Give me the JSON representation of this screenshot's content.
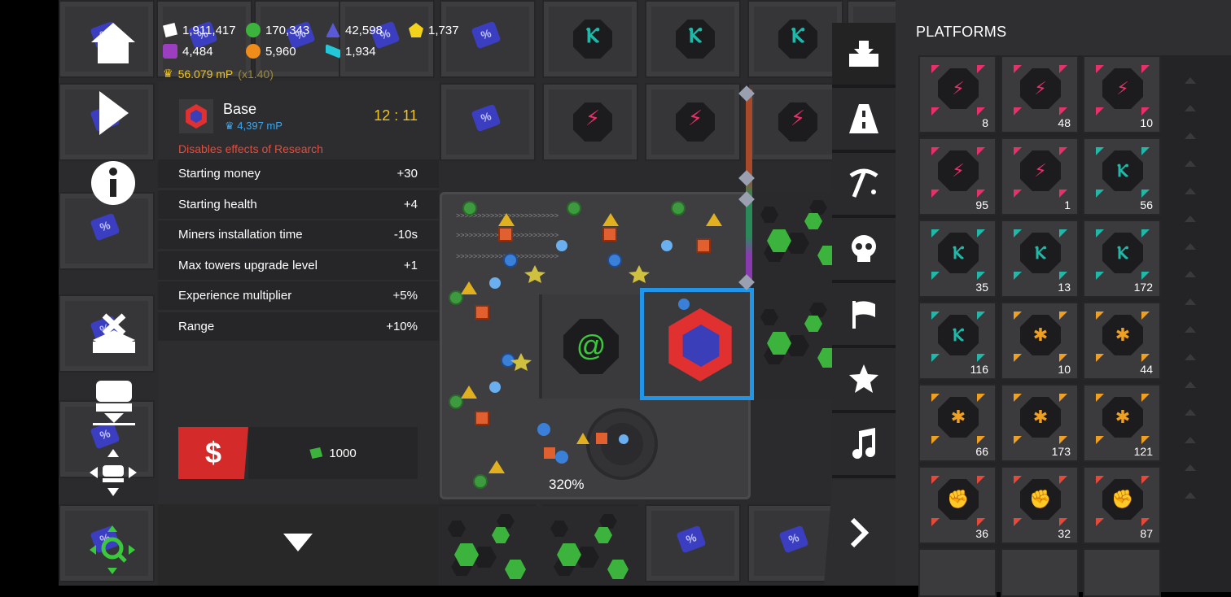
{
  "resources": [
    {
      "icon": "cash-resource-icon",
      "value": "1,911,417",
      "color": "#ffffff"
    },
    {
      "icon": "green-resource-icon",
      "value": "170,343",
      "color": "#3cb33c"
    },
    {
      "icon": "scalar-resource-icon",
      "value": "42,598",
      "color": "#5a5ad8"
    },
    {
      "icon": "yellow-resource-icon",
      "value": "1,737",
      "color": "#f2d21a"
    },
    {
      "icon": "purple-resource-icon",
      "value": "4,484",
      "color": "#9b3fc0"
    },
    {
      "icon": "orange-resource-icon",
      "value": "5,960",
      "color": "#f08c1a"
    },
    {
      "icon": "cyan-resource-icon",
      "value": "1,934",
      "color": "#22c8d8"
    }
  ],
  "mp": {
    "value": "56.079 mP",
    "multiplier": "(x1.40)"
  },
  "base_panel": {
    "title": "Base",
    "mp": "4,397 mP",
    "timer": "12 : 11",
    "warning": "Disables effects of Research",
    "stats": [
      {
        "label": "Starting money",
        "value": "+30"
      },
      {
        "label": "Starting health",
        "value": "+4"
      },
      {
        "label": "Miners installation time",
        "value": "-10s"
      },
      {
        "label": "Max towers upgrade level",
        "value": "+1"
      },
      {
        "label": "Experience multiplier",
        "value": "+5%"
      },
      {
        "label": "Range",
        "value": "+10%"
      }
    ],
    "cost": "1000"
  },
  "zoom": "320%",
  "platforms_title": "PLATFORMS",
  "platforms": [
    {
      "count": "8",
      "color": "#e8306a",
      "glyph": "⚡"
    },
    {
      "count": "48",
      "color": "#e8306a",
      "glyph": "⚡"
    },
    {
      "count": "10",
      "color": "#e8306a",
      "glyph": "⚡"
    },
    {
      "count": "95",
      "color": "#e8306a",
      "glyph": "⚡"
    },
    {
      "count": "1",
      "color": "#e8306a",
      "glyph": "⚡"
    },
    {
      "count": "56",
      "color": "#20b8a8",
      "glyph": "Ⲕ"
    },
    {
      "count": "35",
      "color": "#20b8a8",
      "glyph": "Ⲕ"
    },
    {
      "count": "13",
      "color": "#20b8a8",
      "glyph": "Ⲕ"
    },
    {
      "count": "172",
      "color": "#20b8a8",
      "glyph": "Ⲕ"
    },
    {
      "count": "116",
      "color": "#20b8a8",
      "glyph": "Ⲕ"
    },
    {
      "count": "10",
      "color": "#f0a020",
      "glyph": "✱"
    },
    {
      "count": "44",
      "color": "#f0a020",
      "glyph": "✱"
    },
    {
      "count": "66",
      "color": "#f0a020",
      "glyph": "✱"
    },
    {
      "count": "173",
      "color": "#f0a020",
      "glyph": "✱"
    },
    {
      "count": "121",
      "color": "#f0a020",
      "glyph": "✱"
    },
    {
      "count": "36",
      "color": "#e84838",
      "glyph": "✊"
    },
    {
      "count": "32",
      "color": "#e84838",
      "glyph": "✊"
    },
    {
      "count": "87",
      "color": "#e84838",
      "glyph": "✊"
    }
  ],
  "colors": {
    "accent_blue": "#2196e8",
    "warning_red": "#e84a3a",
    "timer_yellow": "#f2c41a",
    "mp_blue": "#3aa8f0",
    "sell_red": "#d42a2a"
  }
}
